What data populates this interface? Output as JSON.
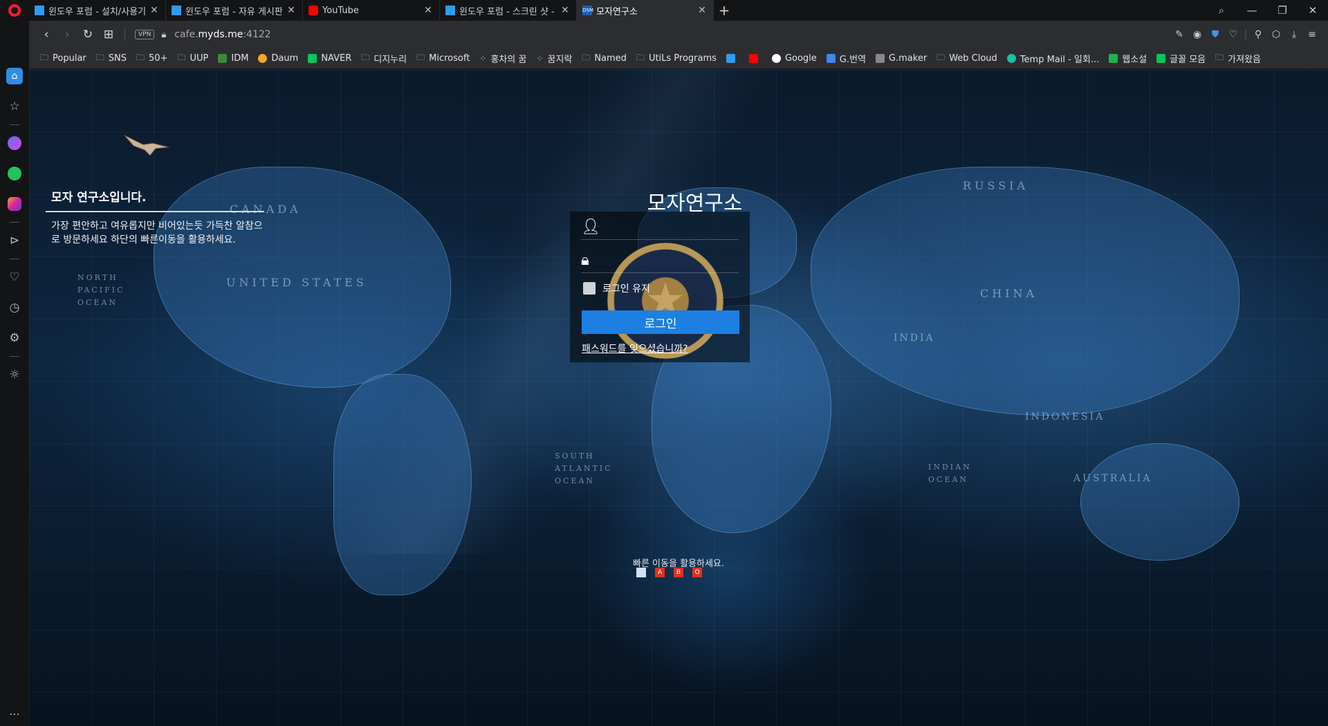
{
  "tabs": [
    {
      "title": "윈도우 포럼 - 설치/사용기",
      "favicon": "windows-icon"
    },
    {
      "title": "윈도우 포럼 - 자유 게시판",
      "favicon": "windows-icon"
    },
    {
      "title": "YouTube",
      "favicon": "youtube-icon"
    },
    {
      "title": "윈도우 포럼 - 스크린 샷 -",
      "favicon": "windows-icon"
    },
    {
      "title": "모자연구소",
      "favicon": "dsm-icon",
      "active": true
    }
  ],
  "address": {
    "vpn": "VPN",
    "url_prefix": "cafe.",
    "url_domain": "myds.me",
    "url_port": ":4122"
  },
  "bookmarks": [
    {
      "label": "Popular",
      "icon": "folder-icon"
    },
    {
      "label": "SNS",
      "icon": "folder-icon"
    },
    {
      "label": "50+",
      "icon": "folder-icon"
    },
    {
      "label": "UUP",
      "icon": "folder-icon"
    },
    {
      "label": "IDM",
      "icon": "idm-icon"
    },
    {
      "label": "Daum",
      "icon": "daum-icon"
    },
    {
      "label": "NAVER",
      "icon": "naver-icon"
    },
    {
      "label": "디지누리",
      "icon": "folder-icon"
    },
    {
      "label": "Microsoft",
      "icon": "folder-icon"
    },
    {
      "label": "홍차의 꿈",
      "icon": "dots-icon"
    },
    {
      "label": "꿈지락",
      "icon": "dots-icon"
    },
    {
      "label": "Named",
      "icon": "folder-icon"
    },
    {
      "label": "UtiLs Programs",
      "icon": "folder-icon"
    },
    {
      "label": "Google",
      "icon": "google-icon"
    },
    {
      "label": "G.번역",
      "icon": "translate-icon"
    },
    {
      "label": "G.maker",
      "icon": "gmaker-icon"
    },
    {
      "label": "Web Cloud",
      "icon": "folder-icon"
    },
    {
      "label": "Temp Mail - 일회...",
      "icon": "tempmail-icon"
    },
    {
      "label": "웹소설",
      "icon": "webnovel-icon"
    },
    {
      "label": "글꼴 모음",
      "icon": "naver-icon"
    },
    {
      "label": "가져왔음",
      "icon": "folder-icon"
    }
  ],
  "welcome": {
    "title": "모자 연구소입니다.",
    "body": "가장 편안하고 여유롭지만 비어있는듯 가득찬 알참으로 방문하세요 하단의 빠른이동을 활용하세요."
  },
  "login": {
    "title": "모자연구소",
    "username_placeholder": "",
    "password_placeholder": "",
    "keep_label": "로그인 유지",
    "button": "로그인",
    "forgot": "패스워드를 잊으셨습니까?"
  },
  "footer": {
    "text": "빠른 이동을 활용하세요.",
    "quick_links": [
      "",
      "A",
      "B",
      "O"
    ]
  },
  "map_labels": [
    "RUSSIA",
    "CANADA",
    "UNITED STATES",
    "CHINA",
    "INDIA",
    "INDONESIA",
    "AUSTRALIA",
    "NORTH PACIFIC OCEAN",
    "SOUTH ATLANTIC OCEAN",
    "INDIAN OCEAN"
  ],
  "colors": {
    "accent": "#1e7fe2",
    "opera_red": "#ff1b2d"
  }
}
